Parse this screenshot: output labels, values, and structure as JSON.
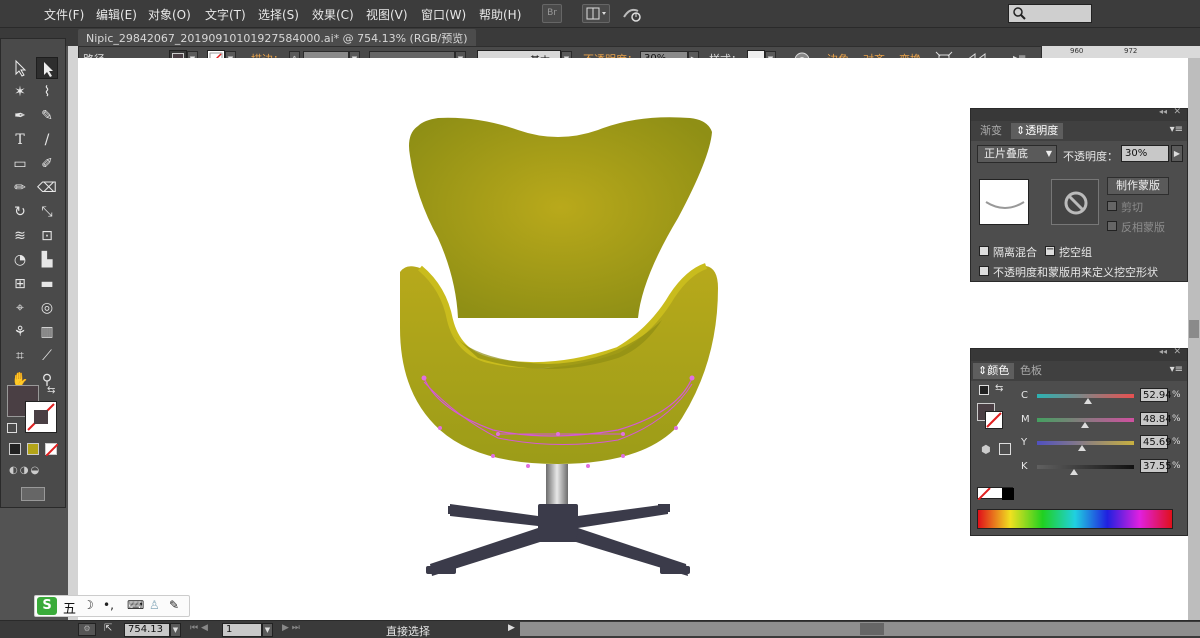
{
  "menubar": {
    "items": [
      "文件(F)",
      "编辑(E)",
      "对象(O)",
      "文字(T)",
      "选择(S)",
      "效果(C)",
      "视图(V)",
      "窗口(W)",
      "帮助(H)"
    ],
    "br_label": "Br"
  },
  "document": {
    "tab_title": "Nipic_29842067_20190910101927584000.ai* @ 754.13% (RGB/预览)"
  },
  "control_bar": {
    "object_type": "路径",
    "stroke_label": "描边",
    "stroke_colon": "：",
    "brush_label": "基本",
    "opacity_label": "不透明度",
    "opacity_colon": "：",
    "opacity_value": "30%",
    "style_label": "样式",
    "style_colon": "：",
    "corner_label": "边角",
    "align_label": "对齐",
    "transform_label": "变换"
  },
  "ruler": {
    "ticks": [
      "960",
      "972"
    ]
  },
  "transparency_panel": {
    "tabs": [
      "渐变",
      "透明度"
    ],
    "blend_mode": "正片叠底",
    "opacity_label": "不透明度：",
    "opacity_value": "30%",
    "make_mask_button": "制作蒙版",
    "clip_label": "剪切",
    "invert_mask_label": "反相蒙版",
    "isolate_blending_label": "隔离混合",
    "knockout_group_label": "挖空组",
    "opacity_mask_knockout_label": "不透明度和蒙版用来定义挖空形状"
  },
  "color_panel": {
    "tabs": [
      "颜色",
      "色板"
    ],
    "channels": [
      {
        "label": "C",
        "value": "52.94",
        "level": 0.53,
        "color_from": "#2bb3b3",
        "color_to": "#e85050"
      },
      {
        "label": "M",
        "value": "48.84",
        "level": 0.49,
        "color_from": "#44a060",
        "color_to": "#d050a0"
      },
      {
        "label": "Y",
        "value": "45.69",
        "level": 0.46,
        "color_from": "#5050c0",
        "color_to": "#c8b040"
      },
      {
        "label": "K",
        "value": "37.55",
        "level": 0.38,
        "color_from": "#606060",
        "color_to": "#111111"
      }
    ],
    "percent_sign": "%"
  },
  "fill_color": "#4a3f44",
  "chair": {
    "seat_color": "#a7a81a",
    "seat_highlight": "#c6b91c",
    "base_color": "#3b3b4a"
  },
  "status_bar": {
    "zoom": "754.13",
    "artboard": "1",
    "tool": "直接选择"
  },
  "ime": {
    "logo": "S",
    "mode": "五",
    "punct": "•,"
  }
}
